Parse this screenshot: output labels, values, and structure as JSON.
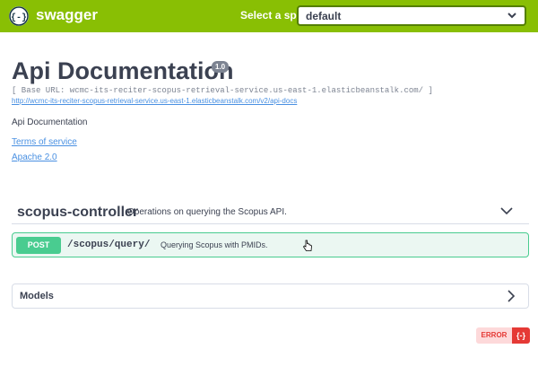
{
  "topbar": {
    "brand": "swagger",
    "select_label": "Select a spec",
    "select_value": "default"
  },
  "info": {
    "title": "Api Documentation",
    "version": "1.0",
    "base_url": "[ Base URL: wcmc-its-reciter-scopus-retrieval-service.us-east-1.elasticbeanstalk.com/ ]",
    "docs_link": "http://wcmc-its-reciter-scopus-retrieval-service.us-east-1.elasticbeanstalk.com/v2/api-docs",
    "description": "Api Documentation",
    "terms_of_service": "Terms of service",
    "license": "Apache 2.0"
  },
  "tag": {
    "name": "scopus-controller",
    "description": "Operations on querying the Scopus API."
  },
  "operation": {
    "method": "POST",
    "path": "/scopus/query/",
    "summary": "Querying Scopus with PMIDs."
  },
  "models": {
    "label": "Models"
  },
  "validator": {
    "label": "ERROR",
    "icon_text": "{-}"
  },
  "colors": {
    "topbar": "#89bf04",
    "post": "#49cc90",
    "link": "#4990e2",
    "error": "#e53935"
  }
}
